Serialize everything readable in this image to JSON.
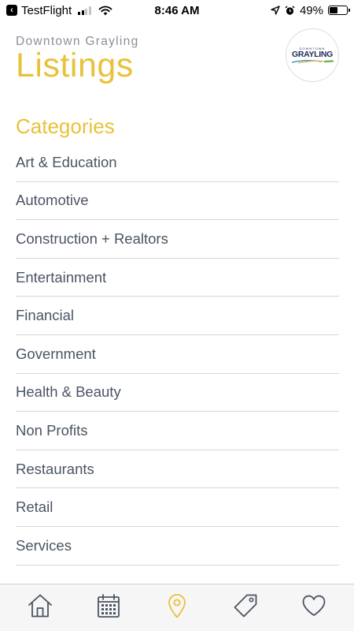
{
  "status_bar": {
    "back_app": "TestFlight",
    "time": "8:46 AM",
    "battery_percent": "49%",
    "battery_level": 0.49,
    "signal_bars_active": 2,
    "signal_bars_total": 4
  },
  "header": {
    "subtitle": "Downtown Grayling",
    "title": "Listings",
    "logo": {
      "small_text": "DOWNTOWN",
      "main_text": "GRAYLING"
    }
  },
  "categories": {
    "title": "Categories",
    "items": [
      "Art & Education",
      "Automotive",
      "Construction + Realtors",
      "Entertainment",
      "Financial",
      "Government",
      "Health & Beauty",
      "Non Profits",
      "Restaurants",
      "Retail",
      "Services"
    ]
  },
  "tab_bar": {
    "active_tab": "locations",
    "tabs": [
      "home",
      "calendar",
      "locations",
      "deals",
      "favorites"
    ]
  },
  "colors": {
    "accent": "#e8c23a",
    "text": "#4b5463",
    "icon": "#4b5463",
    "divider": "#d6d6d6"
  }
}
